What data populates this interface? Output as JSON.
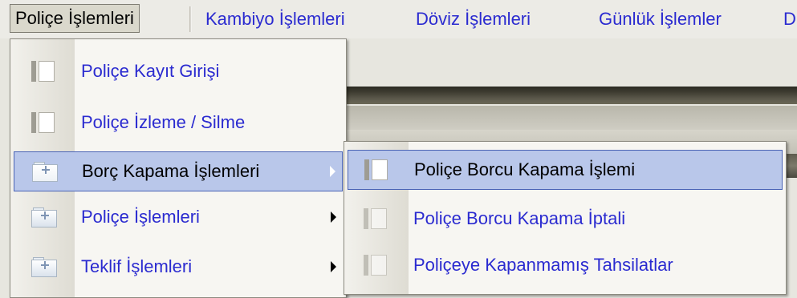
{
  "menubar": {
    "items": [
      {
        "label": "Poliçe İşlemleri",
        "mnemonic": "P"
      },
      {
        "label": "Kambiyo İşlemleri",
        "mnemonic": "a"
      },
      {
        "label": "Döviz İşlemleri",
        "mnemonic": "D"
      },
      {
        "label": "Günlük İşlemler",
        "mnemonic": "G"
      },
      {
        "label": "D",
        "mnemonic": ""
      }
    ]
  },
  "police_menu": {
    "items": [
      {
        "label": "Poliçe Kayıt Girişi",
        "icon": "document-icon"
      },
      {
        "label": "Poliçe İzleme / Silme",
        "icon": "document-icon"
      },
      {
        "label": "Borç Kapama İşlemleri",
        "icon": "folder-icon",
        "submenu": true,
        "highlighted": true
      },
      {
        "label": "Poliçe İşlemleri",
        "icon": "folder-icon",
        "submenu": true
      },
      {
        "label": "Teklif İşlemleri",
        "icon": "folder-icon",
        "submenu": true
      }
    ]
  },
  "borc_submenu": {
    "items": [
      {
        "label": "Poliçe Borcu Kapama İşlemi",
        "icon": "document-icon",
        "highlighted": true
      },
      {
        "label": "Poliçe Borcu Kapama İptali",
        "icon": "document-icon"
      },
      {
        "label": "Poliçeye Kapanmamış Tahsilatlar",
        "icon": "document-icon"
      }
    ]
  },
  "colors": {
    "menu_text": "#2b2bd0",
    "highlight_bg": "#b9c7ea",
    "highlight_border": "#4a64b6"
  }
}
